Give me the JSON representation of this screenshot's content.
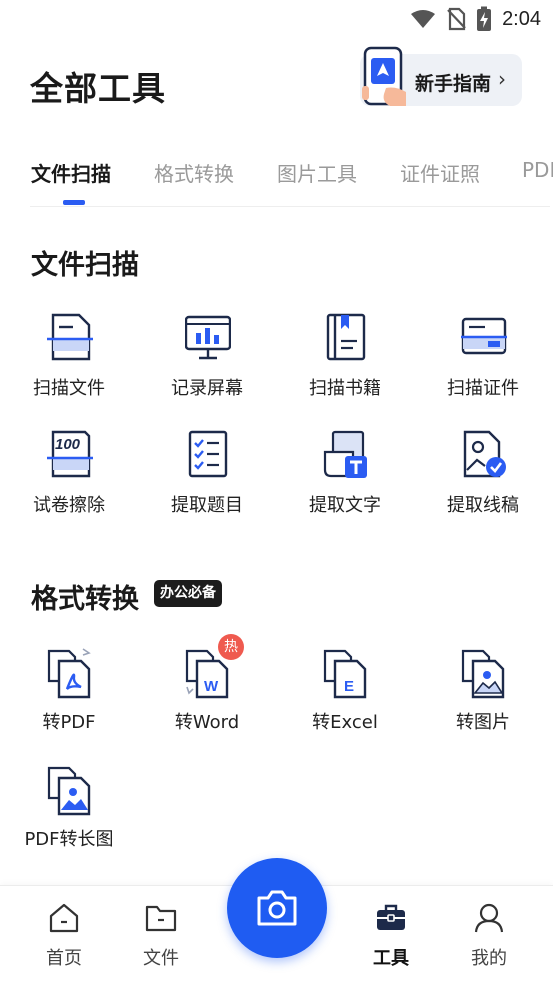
{
  "status_bar": {
    "time": "2:04",
    "icons": [
      "wifi-icon",
      "no-sim-icon",
      "battery-charging-icon"
    ]
  },
  "header": {
    "title": "全部工具",
    "guide_label": "新手指南",
    "guide_chevron": "›"
  },
  "tabs": [
    {
      "label": "文件扫描",
      "active": true
    },
    {
      "label": "格式转换",
      "active": false
    },
    {
      "label": "图片工具",
      "active": false
    },
    {
      "label": "证件证照",
      "active": false
    },
    {
      "label": "PDF",
      "active": false
    }
  ],
  "sections": {
    "scan": {
      "title": "文件扫描",
      "tools": [
        {
          "label": "扫描文件",
          "icon": "scan-document-icon"
        },
        {
          "label": "记录屏幕",
          "icon": "record-screen-icon"
        },
        {
          "label": "扫描书籍",
          "icon": "scan-book-icon"
        },
        {
          "label": "扫描证件",
          "icon": "scan-id-card-icon"
        },
        {
          "label": "试卷擦除",
          "icon": "erase-exam-icon"
        },
        {
          "label": "提取题目",
          "icon": "extract-questions-icon"
        },
        {
          "label": "提取文字",
          "icon": "extract-text-icon"
        },
        {
          "label": "提取线稿",
          "icon": "extract-lineart-icon"
        }
      ]
    },
    "convert": {
      "title": "格式转换",
      "badge": "办公必备",
      "hot_badge": "热",
      "tools": [
        {
          "label": "转PDF",
          "icon": "to-pdf-icon"
        },
        {
          "label": "转Word",
          "icon": "to-word-icon"
        },
        {
          "label": "转Excel",
          "icon": "to-excel-icon"
        },
        {
          "label": "转图片",
          "icon": "to-image-icon"
        },
        {
          "label": "PDF转长图",
          "icon": "pdf-to-long-image-icon"
        }
      ]
    }
  },
  "bottom_nav": [
    {
      "label": "首页",
      "icon": "home-icon",
      "active": false
    },
    {
      "label": "文件",
      "icon": "folder-icon",
      "active": false
    },
    {
      "label": "工具",
      "icon": "toolbox-icon",
      "active": true
    },
    {
      "label": "我的",
      "icon": "profile-icon",
      "active": false
    }
  ],
  "colors": {
    "accent": "#1f5cf2",
    "icon_stroke": "#1d2a4a",
    "hot": "#ef5a4f"
  }
}
